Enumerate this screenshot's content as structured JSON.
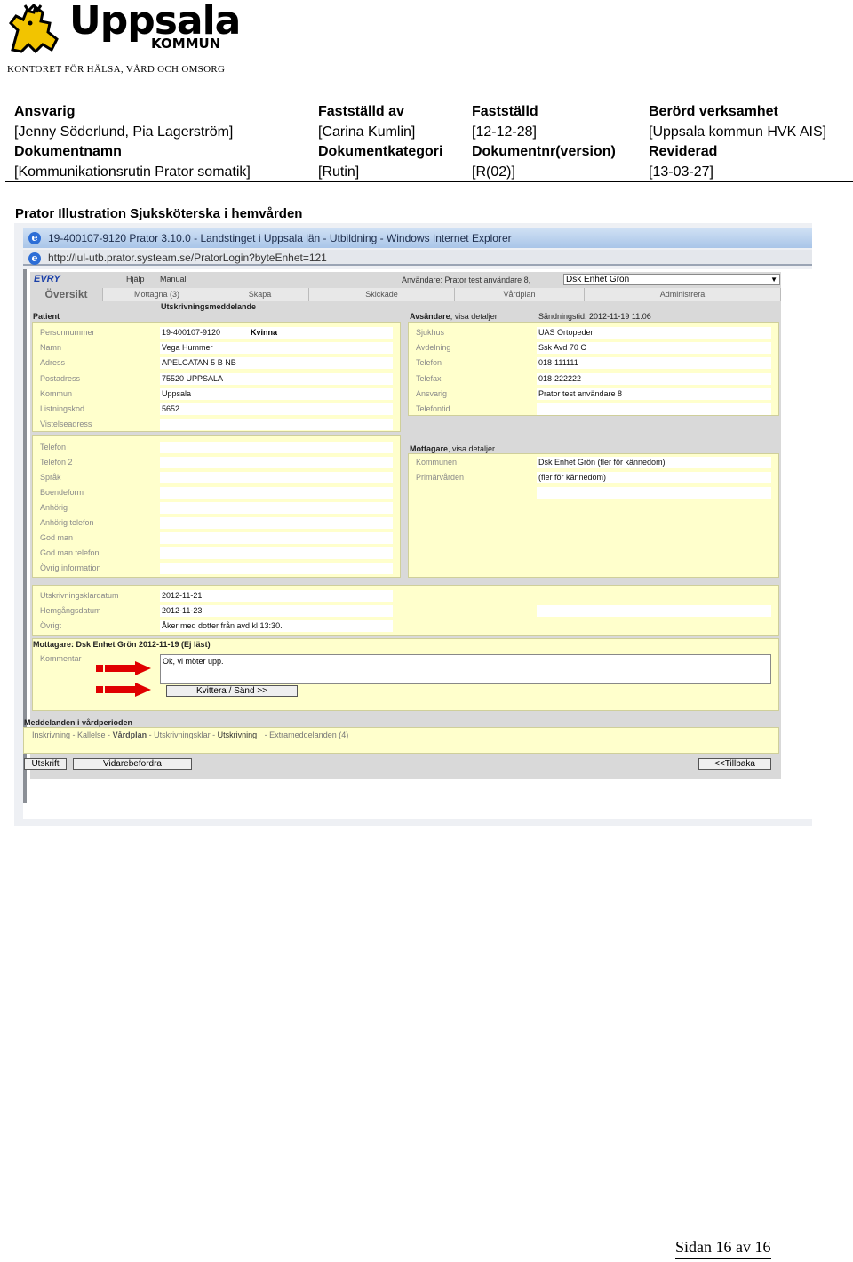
{
  "logo": {
    "word": "Uppsala",
    "kommun": "KOMMUN",
    "subtitle": "KONTORET FÖR HÄLSA, VÅRD OCH OMSORG"
  },
  "header": {
    "ansvarig_label": "Ansvarig",
    "ansvarig_value": "[Jenny Söderlund, Pia Lagerström]",
    "faststalld_av_label": "Fastställd av",
    "faststalld_av_value": "[Carina Kumlin]",
    "faststalld_label": "Fastställd",
    "faststalld_value": "[12-12-28]",
    "berord_label": "Berörd verksamhet",
    "berord_value": "[Uppsala kommun HVK AIS]",
    "dokumentnamn_label": "Dokumentnamn",
    "dokumentnamn_value": "[Kommunikationsrutin Prator somatik]",
    "dokumentkategori_label": "Dokumentkategori",
    "dokumentkategori_value": "[Rutin]",
    "dokumentnr_label": "Dokumentnr(version)",
    "dokumentnr_value": "[R(02)]",
    "reviderad_label": "Reviderad",
    "reviderad_value": "[13-03-27]"
  },
  "caption": "Prator Illustration Sjuksköterska i hemvården",
  "browser": {
    "title": "19-400107-9120   Prator 3.10.0 - Landstinget i Uppsala län - Utbildning - Windows Internet Explorer",
    "address": "http://lul-utb.prator.systeam.se/PratorLogin?byteEnhet=121"
  },
  "app": {
    "brand": "EVRY",
    "menu_help": "Hjälp",
    "menu_manual": "Manual",
    "user_label": "Användare: Prator test användare 8,",
    "unit_selected": "Dsk Enhet Grön",
    "tabs": [
      "Översikt",
      "Mottagna (3)",
      "Skapa",
      "Skickade",
      "Vårdplan",
      "Administrera"
    ],
    "patient_header": "Patient",
    "message_title": "Utskrivningsmeddelande",
    "patient_rows": [
      {
        "label": "Personnummer",
        "value": "19-400107-9120",
        "extra": "Kvinna"
      },
      {
        "label": "Namn",
        "value": "Vega  Hummer"
      },
      {
        "label": "Adress",
        "value": "APELGATAN 5 B NB"
      },
      {
        "label": "Postadress",
        "value": "75520  UPPSALA"
      },
      {
        "label": "Kommun",
        "value": "Uppsala"
      },
      {
        "label": "Listningskod",
        "value": "5652"
      },
      {
        "label": "Vistelseadress",
        "value": ""
      }
    ],
    "patient_rows2": [
      {
        "label": "Telefon",
        "value": ""
      },
      {
        "label": "Telefon 2",
        "value": ""
      },
      {
        "label": "Språk",
        "value": ""
      },
      {
        "label": "Boendeform",
        "value": ""
      },
      {
        "label": "Anhörig",
        "value": ""
      },
      {
        "label": "Anhörig telefon",
        "value": ""
      },
      {
        "label": "God man",
        "value": ""
      },
      {
        "label": "God man telefon",
        "value": ""
      },
      {
        "label": "Övrig information",
        "value": ""
      }
    ],
    "sender_header": "Avsändare",
    "sender_details": ", visa detaljer",
    "send_time": "Sändningstid: 2012-11-19 11:06",
    "sender_rows": [
      {
        "label": "Sjukhus",
        "value": "UAS Ortopeden"
      },
      {
        "label": "Avdelning",
        "value": "Ssk Avd 70 C"
      },
      {
        "label": "Telefon",
        "value": "018-111111"
      },
      {
        "label": "Telefax",
        "value": "018-222222"
      },
      {
        "label": "Ansvarig",
        "value": "Prator test användare 8"
      },
      {
        "label": "Telefontid",
        "value": ""
      }
    ],
    "receiver_header": "Mottagare",
    "receiver_details": ", visa detaljer",
    "receiver_rows": [
      {
        "label": "Kommunen",
        "value": "Dsk Enhet Grön (fler för kännedom)"
      },
      {
        "label": "Primärvården",
        "value": "(fler för kännedom)"
      }
    ],
    "discharge_rows": [
      {
        "label": "Utskrivningsklardatum",
        "value": "2012-11-21"
      },
      {
        "label": "Hemgångsdatum",
        "value": "2012-11-23"
      },
      {
        "label": "Övrigt",
        "value": "Åker med dotter från avd kl 13:30."
      }
    ],
    "recipient_status": "Mottagare: Dsk Enhet Grön 2012-11-19  (Ej läst)",
    "kommentar_label": "Kommentar",
    "kommentar_value": "Ok, vi möter upp.",
    "kvittera_button": "Kvittera / Sänd >>",
    "messages_header": "Meddelanden i vårdperioden",
    "msg_inskrivning": "Inskrivning -",
    "msg_kallelse": "Kallelse  -",
    "msg_vardplan": "Vårdplan",
    "msg_sep": " -  ",
    "msg_utskrivningsklar": "Utskrivningsklar  -",
    "msg_utskrivning": "Utskrivning",
    "msg_extra": "Extrameddelanden (4)",
    "btn_utskrift": "Utskrift",
    "btn_vidarebefordra": "Vidarebefordra",
    "btn_tillbaka": "<<Tillbaka"
  },
  "footer": "Sidan 16 av 16"
}
